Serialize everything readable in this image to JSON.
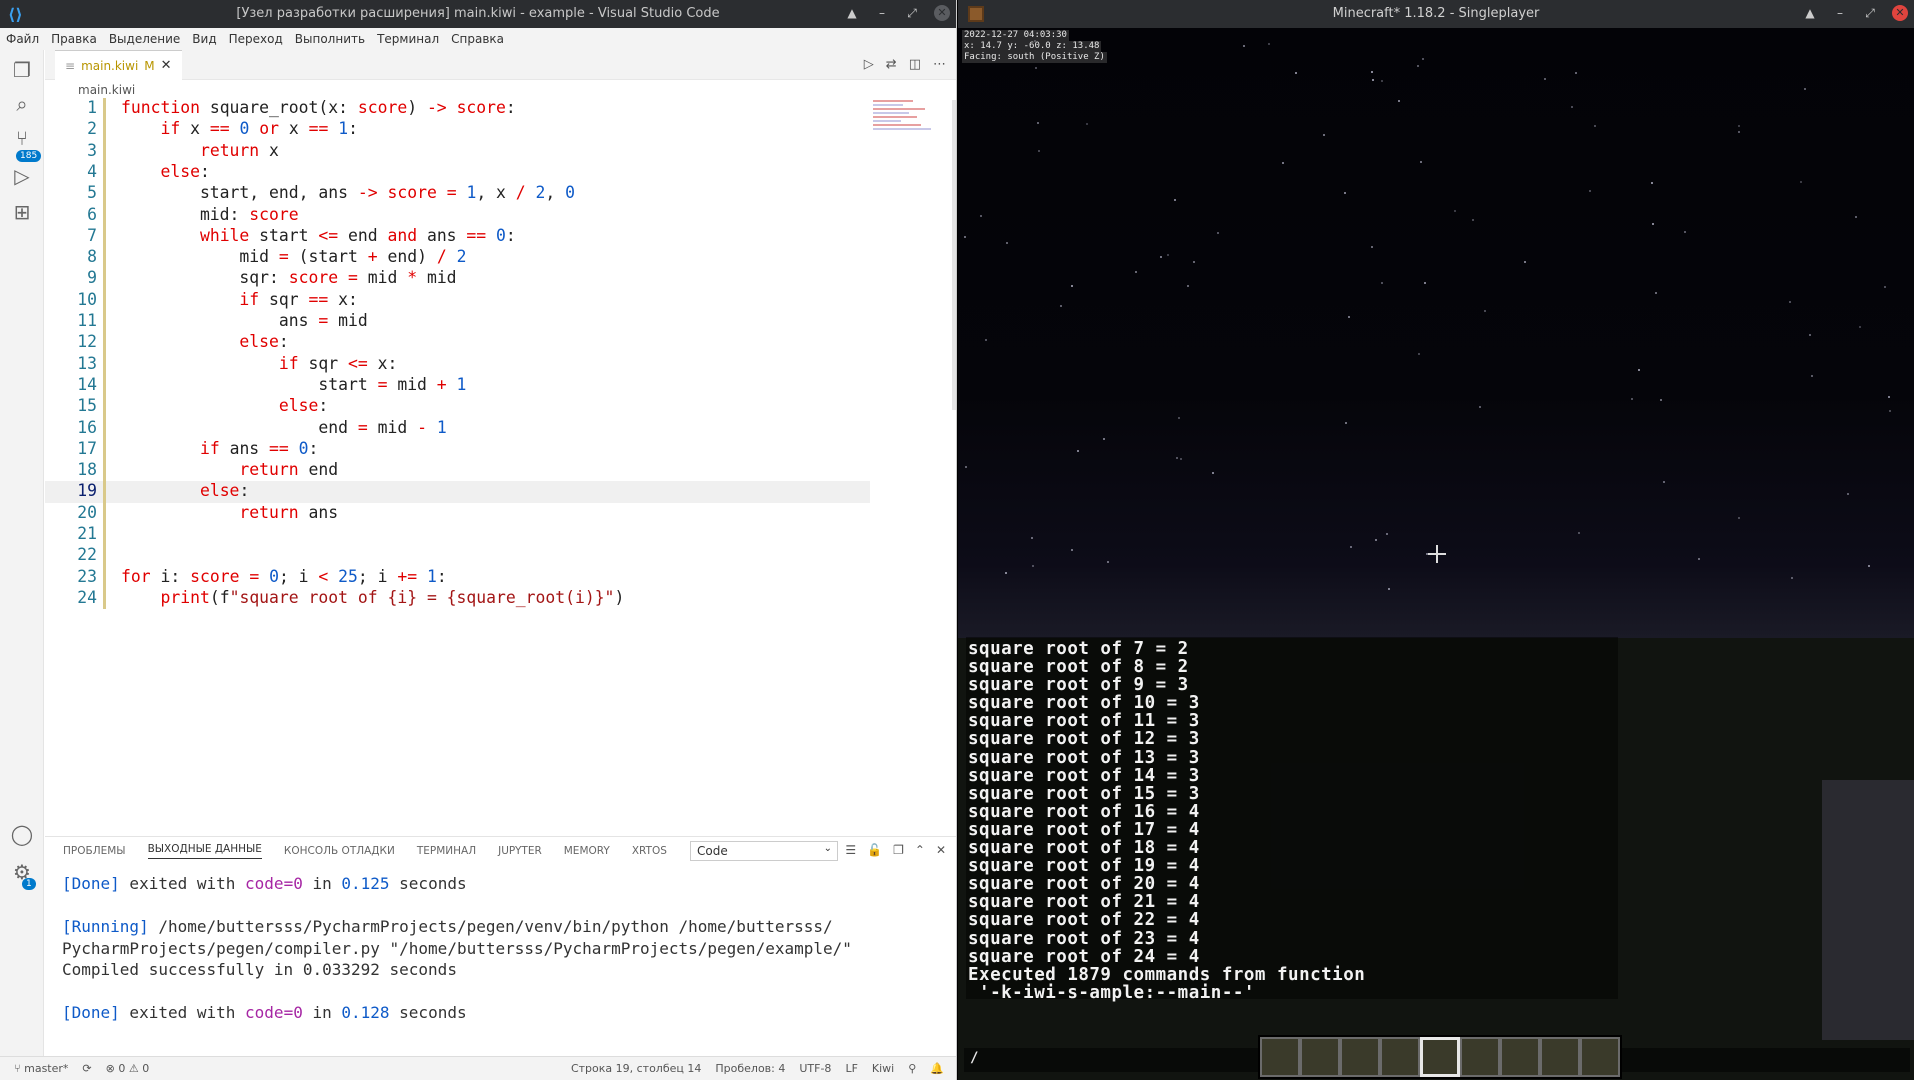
{
  "vscode": {
    "title": "[Узел разработки расширения] main.kiwi - example - Visual Studio Code",
    "menu": [
      "Файл",
      "Правка",
      "Выделение",
      "Вид",
      "Переход",
      "Выполнить",
      "Терминал",
      "Справка"
    ],
    "activity_badges": {
      "scm": "185",
      "settings": "1"
    },
    "tab": {
      "label": "main.kiwi",
      "status": "M"
    },
    "breadcrumb": "main.kiwi",
    "current_line": 19,
    "code": [
      {
        "n": 1,
        "html": "<span class=\"kw\">function</span> square_root(x: <span class=\"kw\">score</span>) <span class=\"kw\">-&gt;</span> <span class=\"kw\">score</span>:"
      },
      {
        "n": 2,
        "html": "    <span class=\"kw\">if</span> x <span class=\"kw\">==</span> <span class=\"num\">0</span> <span class=\"kw\">or</span> x <span class=\"kw\">==</span> <span class=\"num\">1</span>:"
      },
      {
        "n": 3,
        "html": "        <span class=\"kw\">return</span> x"
      },
      {
        "n": 4,
        "html": "    <span class=\"kw\">else</span>:"
      },
      {
        "n": 5,
        "html": "        start, end, ans <span class=\"kw\">-&gt;</span> <span class=\"kw\">score</span> <span class=\"kw\">=</span> <span class=\"num\">1</span>, x <span class=\"kw\">/</span> <span class=\"num\">2</span>, <span class=\"num\">0</span>"
      },
      {
        "n": 6,
        "html": "        mid: <span class=\"kw\">score</span>"
      },
      {
        "n": 7,
        "html": "        <span class=\"kw\">while</span> start <span class=\"kw\">&lt;=</span> end <span class=\"kw\">and</span> ans <span class=\"kw\">==</span> <span class=\"num\">0</span>:"
      },
      {
        "n": 8,
        "html": "            mid <span class=\"kw\">=</span> (start <span class=\"kw\">+</span> end) <span class=\"kw\">/</span> <span class=\"num\">2</span>"
      },
      {
        "n": 9,
        "html": "            sqr: <span class=\"kw\">score</span> <span class=\"kw\">=</span> mid <span class=\"kw\">*</span> mid"
      },
      {
        "n": 10,
        "html": "            <span class=\"kw\">if</span> sqr <span class=\"kw\">==</span> x:"
      },
      {
        "n": 11,
        "html": "                ans <span class=\"kw\">=</span> mid"
      },
      {
        "n": 12,
        "html": "            <span class=\"kw\">else</span>:"
      },
      {
        "n": 13,
        "html": "                <span class=\"kw\">if</span> sqr <span class=\"kw\">&lt;=</span> x:"
      },
      {
        "n": 14,
        "html": "                    start <span class=\"kw\">=</span> mid <span class=\"kw\">+</span> <span class=\"num\">1</span>"
      },
      {
        "n": 15,
        "html": "                <span class=\"kw\">else</span>:"
      },
      {
        "n": 16,
        "html": "                    end <span class=\"kw\">=</span> mid <span class=\"kw\">-</span> <span class=\"num\">1</span>"
      },
      {
        "n": 17,
        "html": "        <span class=\"kw\">if</span> ans <span class=\"kw\">==</span> <span class=\"num\">0</span>:"
      },
      {
        "n": 18,
        "html": "            <span class=\"kw\">return</span> end"
      },
      {
        "n": 19,
        "html": "        <span class=\"kw\">else</span>:"
      },
      {
        "n": 20,
        "html": "            <span class=\"kw\">return</span> ans"
      },
      {
        "n": 21,
        "html": ""
      },
      {
        "n": 22,
        "html": ""
      },
      {
        "n": 23,
        "html": "<span class=\"kw\">for</span> i: <span class=\"kw\">score</span> <span class=\"kw\">=</span> <span class=\"num\">0</span>; i <span class=\"kw\">&lt;</span> <span class=\"num\">25</span>; i <span class=\"kw\">+=</span> <span class=\"num\">1</span>:"
      },
      {
        "n": 24,
        "html": "    <span class=\"kw\">print</span>(f<span class=\"str\">\"square root of {i} = {square_root(i)}\"</span>)"
      }
    ],
    "panel": {
      "tabs": [
        "ПРОБЛЕМЫ",
        "ВЫХОДНЫЕ ДАННЫЕ",
        "КОНСОЛЬ ОТЛАДКИ",
        "ТЕРМИНАЛ",
        "JUPYTER",
        "MEMORY",
        "XRTOS"
      ],
      "active_tab": "ВЫХОДНЫЕ ДАННЫЕ",
      "select_value": "Code",
      "output": [
        {
          "html": "<span class=\"done\">[Done]</span> exited with <span class=\"mag\">code=0</span> in <span class=\"done\">0.125</span> seconds"
        },
        {
          "html": ""
        },
        {
          "html": "<span class=\"done\">[Running]</span> /home/buttersss/PycharmProjects/pegen/venv/bin/python /home/buttersss/"
        },
        {
          "html": "PycharmProjects/pegen/compiler.py \"/home/buttersss/PycharmProjects/pegen/example/\""
        },
        {
          "html": "Compiled successfully in 0.033292 seconds"
        },
        {
          "html": ""
        },
        {
          "html": "<span class=\"done\">[Done]</span> exited with <span class=\"mag\">code=0</span> in <span class=\"done\">0.128</span> seconds"
        }
      ]
    },
    "status": {
      "branch": "master*",
      "problems": "0",
      "warnings": "0",
      "position": "Строка 19, столбец 14",
      "spaces": "Пробелов: 4",
      "encoding": "UTF-8",
      "eol": "LF",
      "language": "Kiwi"
    }
  },
  "minecraft": {
    "title": "Minecraft* 1.18.2 - Singleplayer",
    "debug": [
      "2022-12-27 04:03:30",
      "x: 14.7 y: -60.0 z: 13.48",
      "Facing: south (Positive Z)"
    ],
    "chat": [
      "square root of 7 = 2",
      "square root of 8 = 2",
      "square root of 9 = 3",
      "square root of 10 = 3",
      "square root of 11 = 3",
      "square root of 12 = 3",
      "square root of 13 = 3",
      "square root of 14 = 3",
      "square root of 15 = 3",
      "square root of 16 = 4",
      "square root of 17 = 4",
      "square root of 18 = 4",
      "square root of 19 = 4",
      "square root of 20 = 4",
      "square root of 21 = 4",
      "square root of 22 = 4",
      "square root of 23 = 4",
      "square root of 24 = 4",
      "Executed 1879 commands from function",
      " '-k-iwi-s-ample:--main--'"
    ],
    "chat_input": "/",
    "hotbar_selected": 4
  }
}
